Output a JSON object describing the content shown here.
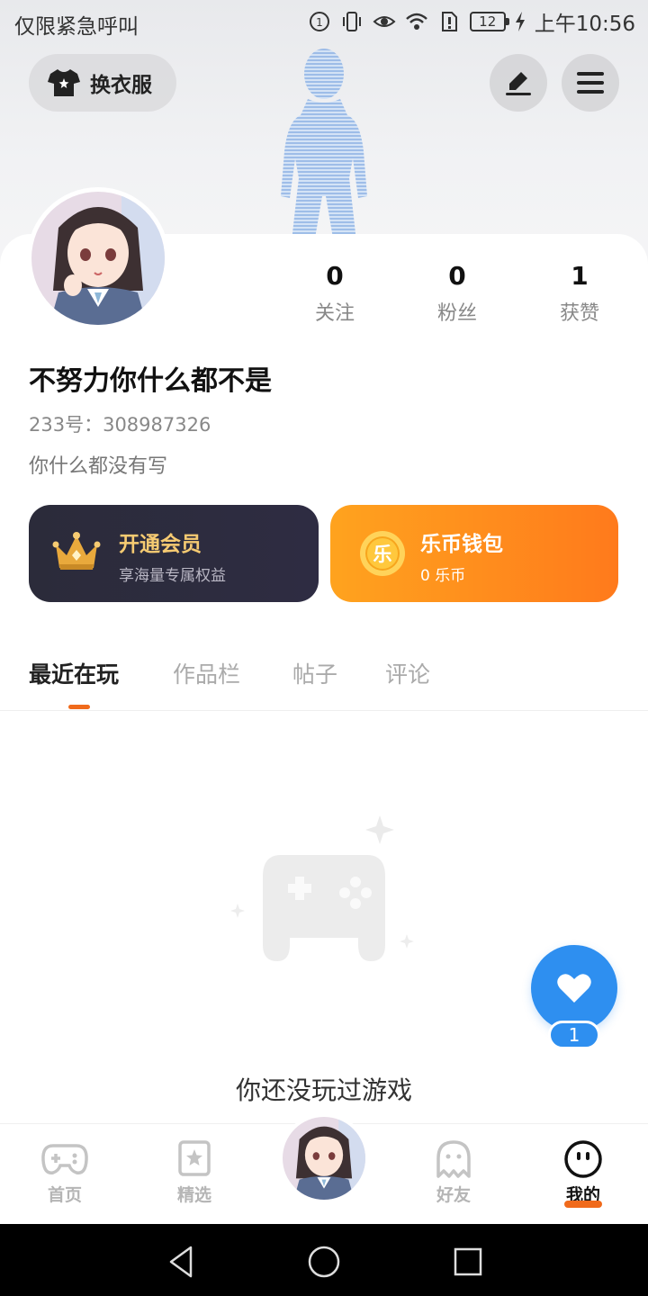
{
  "status_bar": {
    "carrier_text": "仅限紧急呼叫",
    "battery": "12",
    "time": "上午10:56"
  },
  "header": {
    "outfit_label": "换衣服",
    "icons": [
      "tshirt-icon",
      "edit-icon",
      "menu-icon"
    ]
  },
  "profile": {
    "stats": [
      {
        "value": "0",
        "label": "关注"
      },
      {
        "value": "0",
        "label": "粉丝"
      },
      {
        "value": "1",
        "label": "获赞"
      }
    ],
    "username": "不努力你什么都不是",
    "uid": "233号：308987326",
    "bio": "你什么都没有写"
  },
  "cards": {
    "vip": {
      "title": "开通会员",
      "subtitle": "享海量专属权益",
      "icon": "crown-icon"
    },
    "wallet": {
      "title": "乐币钱包",
      "subtitle": "0 乐币",
      "coin_glyph": "乐",
      "icon": "coin-icon"
    }
  },
  "tabs": [
    {
      "label": "最近在玩",
      "active": true
    },
    {
      "label": "作品栏",
      "active": false
    },
    {
      "label": "帖子",
      "active": false
    },
    {
      "label": "评论",
      "active": false
    }
  ],
  "empty_state": {
    "message": "你还没玩过游戏"
  },
  "favorite": {
    "count": "1"
  },
  "bottom_nav": [
    {
      "label": "首页",
      "icon": "gamepad-icon"
    },
    {
      "label": "精选",
      "icon": "star-bookmark-icon"
    },
    {
      "label": "好友",
      "icon": "ghost-icon"
    },
    {
      "label": "我的",
      "icon": "smiley-icon",
      "active": true
    }
  ],
  "colors": {
    "accent": "#f06a1b",
    "vip_bg": "#2b2b3a",
    "vip_gold": "#f6cb72",
    "wallet_orange": "#ff8c1c",
    "fav_blue": "#2e8ff0"
  }
}
